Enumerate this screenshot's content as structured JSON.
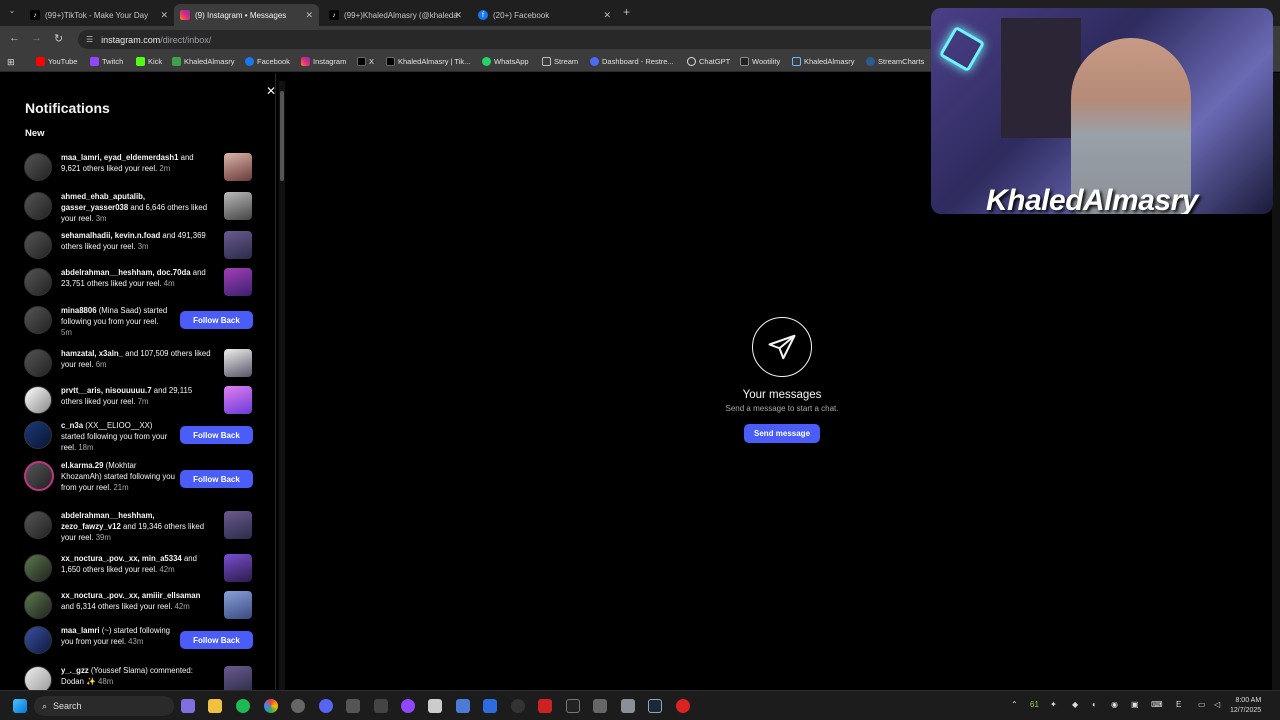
{
  "browser": {
    "tabs": [
      {
        "title": "(99+)TikTok - Make Your Day",
        "active": false
      },
      {
        "title": "(9) Instagram • Messages",
        "active": true
      },
      {
        "title": "(99+)KhaledAlmasry (@khaleda",
        "active": false
      },
      {
        "title": "(20+) Facebook",
        "active": false
      }
    ],
    "url_host": "instagram.com",
    "url_path": "/direct/inbox/",
    "bookmarks": [
      "YouTube",
      "Twitch",
      "Kick",
      "KhaledAlmasry",
      "Facebook",
      "Instagram",
      "X",
      "KhaledAlmasry | Tik...",
      "WhatsApp",
      "Stream",
      "Dashboard - Restre...",
      "ChatGPT",
      "Wootility",
      "KhaledAlmasry",
      "StreamCharts"
    ]
  },
  "notifications": {
    "title": "Notifications",
    "section": "New",
    "follow_back_label": "Follow Back",
    "items": [
      {
        "user": "maa_lamri, eyad_eldemerdash1",
        "text": " and 9,621 others liked your reel.",
        "time": "2m",
        "action": "thumb"
      },
      {
        "user": "ahmed_ehab_aputalib, gasser_yasser038",
        "text": " and 6,646 others liked your reel.",
        "time": "3m",
        "action": "thumb"
      },
      {
        "user": "sehamalhadii, kevin.n.foad",
        "text": " and 491,369 others liked your reel.",
        "time": "3m",
        "action": "thumb"
      },
      {
        "user": "abdelrahman__heshham, doc.70da",
        "text": " and 23,751 others liked your reel.",
        "time": "4m",
        "action": "thumb"
      },
      {
        "user": "mina8806",
        "text": " (Mina Saad) started following you from your reel.",
        "time": "5m",
        "action": "follow"
      },
      {
        "user": "hamzatal, x3aln_",
        "text": " and 107,509 others liked your reel.",
        "time": "6m",
        "action": "thumb"
      },
      {
        "user": "prvtt__aris, nisouuuuu.7",
        "text": " and 29,115 others liked your reel.",
        "time": "7m",
        "action": "thumb"
      },
      {
        "user": "c_n3a",
        "text": " (XX__ELIOO__XX) started following you from your reel.",
        "time": "18m",
        "action": "follow"
      },
      {
        "user": "el.karma.29",
        "text": " (Mokhtar KhozamAh) started following you from your reel.",
        "time": "21m",
        "action": "follow"
      },
      {
        "user": "abdelrahman__heshham, zezo_fawzy_v12",
        "text": " and 19,346 others liked your reel.",
        "time": "39m",
        "action": "thumb"
      },
      {
        "user": "xx_noctura_.pov._xx, min_a5334",
        "text": " and 1,650 others liked your reel.",
        "time": "42m",
        "action": "thumb"
      },
      {
        "user": "xx_noctura_.pov._xx, amiiir_ellsaman",
        "text": " and 6,314 others liked your reel.",
        "time": "42m",
        "action": "thumb"
      },
      {
        "user": "maa_lamri",
        "text": " (~) started following you from your reel.",
        "time": "43m",
        "action": "follow"
      },
      {
        "user": "y_._gzz",
        "text": " (Youssef Slama) commented: Dodan ✨",
        "time": "48m",
        "action": "thumb"
      }
    ]
  },
  "messages": {
    "title": "Your messages",
    "subtitle": "Send a message to start a chat.",
    "button": "Send message"
  },
  "webcam": {
    "name": "KhaledAlmasry"
  },
  "taskbar": {
    "search": "Search",
    "tray_count": "61",
    "time": "8:00 AM",
    "date": "12/7/2025"
  }
}
